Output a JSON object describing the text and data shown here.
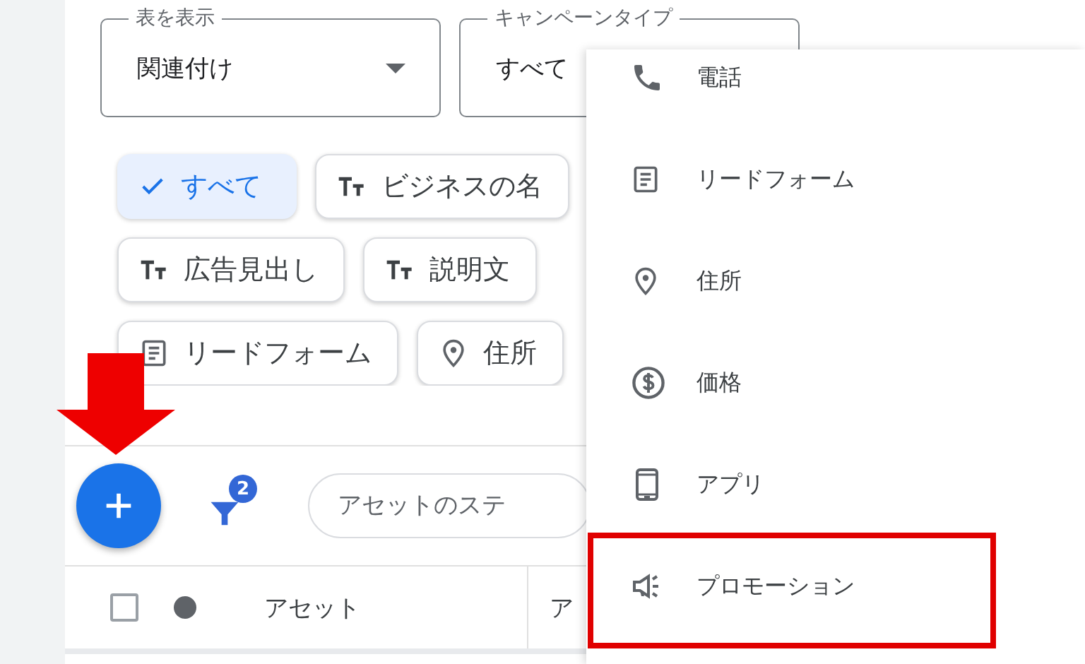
{
  "fields": [
    {
      "label": "表を表示",
      "value": "関連付け",
      "dropdown": true
    },
    {
      "label": "キャンペーンタイプ",
      "value": "すべて"
    }
  ],
  "chip_rows": [
    [
      {
        "label": "すべて",
        "kind": "check",
        "selected": true
      },
      {
        "label": "ビジネスの名",
        "kind": "text",
        "selected": false
      }
    ],
    [
      {
        "label": "広告見出し",
        "kind": "text",
        "selected": false
      },
      {
        "label": "説明文",
        "kind": "text",
        "selected": false
      }
    ],
    [
      {
        "label": "リードフォーム",
        "kind": "form",
        "selected": false
      },
      {
        "label": "住所",
        "kind": "pin",
        "selected": false
      }
    ]
  ],
  "toolbar": {
    "filter_badge": "2",
    "search_placeholder": "アセットのステ"
  },
  "table": {
    "select_all_checked": false,
    "columns": [
      "アセット",
      "ア"
    ]
  },
  "menu": [
    {
      "label": "電話",
      "kind": "phone",
      "highlighted": false
    },
    {
      "label": "リードフォーム",
      "kind": "form",
      "highlighted": false
    },
    {
      "label": "住所",
      "kind": "pin",
      "highlighted": false
    },
    {
      "label": "価格",
      "kind": "price",
      "highlighted": false
    },
    {
      "label": "アプリ",
      "kind": "phone-device",
      "highlighted": false
    },
    {
      "label": "プロモーション",
      "kind": "megaphone",
      "highlighted": true
    }
  ]
}
